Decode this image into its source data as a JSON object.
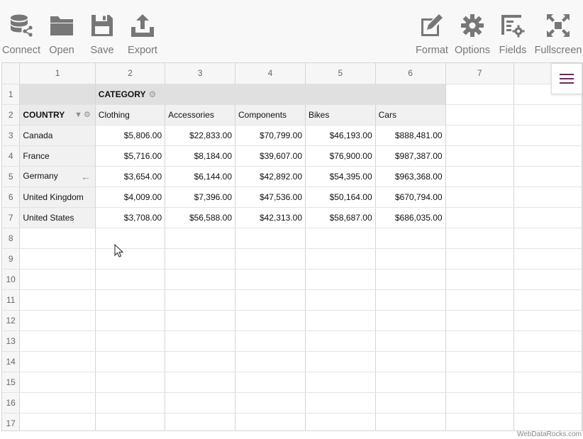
{
  "toolbar": {
    "left": [
      {
        "label": "Connect",
        "icon": "database-connect-icon"
      },
      {
        "label": "Open",
        "icon": "folder-icon"
      },
      {
        "label": "Save",
        "icon": "floppy-disk-icon"
      },
      {
        "label": "Export",
        "icon": "export-icon"
      }
    ],
    "right": [
      {
        "label": "Format",
        "icon": "pencil-icon"
      },
      {
        "label": "Options",
        "icon": "gear-icon"
      },
      {
        "label": "Fields",
        "icon": "fields-icon"
      },
      {
        "label": "Fullscreen",
        "icon": "fullscreen-icon"
      }
    ]
  },
  "grid": {
    "column_numbers": [
      "1",
      "2",
      "3",
      "4",
      "5",
      "6",
      "7"
    ],
    "row_numbers": [
      "1",
      "2",
      "3",
      "4",
      "5",
      "6",
      "7",
      "8",
      "9",
      "10",
      "11",
      "12",
      "13",
      "14",
      "15",
      "16",
      "17"
    ],
    "category_header": "CATEGORY",
    "country_header": "COUNTRY",
    "categories": [
      "Clothing",
      "Accessories",
      "Components",
      "Bikes",
      "Cars"
    ],
    "rows": [
      {
        "country": "Canada",
        "values": [
          "$5,806.00",
          "$22,833.00",
          "$70,799.00",
          "$46,193.00",
          "$888,481.00"
        ]
      },
      {
        "country": "France",
        "values": [
          "$5,716.00",
          "$8,184.00",
          "$39,607.00",
          "$76,900.00",
          "$987,387.00"
        ]
      },
      {
        "country": "Germany",
        "values": [
          "$3,654.00",
          "$6,144.00",
          "$42,892.00",
          "$54,395.00",
          "$963,368.00"
        ]
      },
      {
        "country": "United Kingdom",
        "values": [
          "$4,009.00",
          "$7,396.00",
          "$47,536.00",
          "$50,164.00",
          "$670,794.00"
        ]
      },
      {
        "country": "United States",
        "values": [
          "$3,708.00",
          "$56,588.00",
          "$42,313.00",
          "$58,687.00",
          "$686,035.00"
        ]
      }
    ]
  },
  "footer": {
    "credit": "WebDataRocks.com"
  },
  "colors": {
    "accent": "#6a2a5e",
    "toolbar_icon": "#777777",
    "header_bg": "#e0e0e0"
  }
}
